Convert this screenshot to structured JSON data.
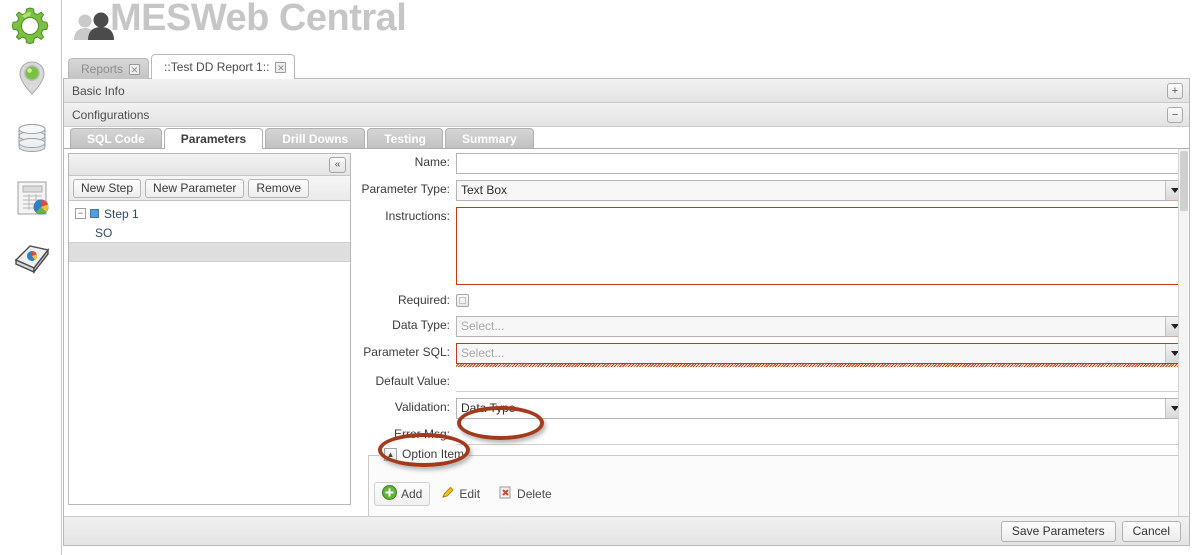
{
  "app": {
    "title": "MESWeb Central",
    "gear_icon": "gear-icon",
    "users_icon": "users-icon"
  },
  "rail": {
    "items": [
      {
        "icon": "location-pin-icon",
        "label": "Location"
      },
      {
        "icon": "database-icon",
        "label": "Database"
      },
      {
        "icon": "report-chart-icon",
        "label": "Reports"
      },
      {
        "icon": "report-stack-icon",
        "label": "Report Library"
      }
    ]
  },
  "top_tabs": [
    {
      "label": "Reports",
      "active": false,
      "close_icon": "close-icon"
    },
    {
      "label": "::Test DD Report 1::",
      "active": true,
      "close_icon": "close-icon"
    }
  ],
  "accordion": {
    "basic_info": {
      "label": "Basic Info",
      "button": "+",
      "button_icon": "plus-icon"
    },
    "configurations": {
      "label": "Configurations",
      "button": "−",
      "button_icon": "minus-icon"
    }
  },
  "inner_tabs": [
    {
      "label": "SQL Code",
      "active": false
    },
    {
      "label": "Parameters",
      "active": true
    },
    {
      "label": "Drill Downs",
      "active": false
    },
    {
      "label": "Testing",
      "active": false
    },
    {
      "label": "Summary",
      "active": false
    }
  ],
  "tree_panel": {
    "collapse_button": "«",
    "collapse_icon": "chevron-double-left-icon",
    "toolbar": [
      {
        "label": "New Step"
      },
      {
        "label": "New Parameter"
      },
      {
        "label": "Remove"
      }
    ],
    "nodes": [
      {
        "label": "Step 1",
        "expander": "−",
        "level": 0
      },
      {
        "label": "SO",
        "level": 1
      }
    ]
  },
  "form": {
    "name": {
      "label": "Name:",
      "value": "",
      "placeholder": ""
    },
    "parameter_type": {
      "label": "Parameter Type:",
      "value": "Text Box"
    },
    "instructions": {
      "label": "Instructions:",
      "value": ""
    },
    "required": {
      "label": "Required:",
      "checked": false
    },
    "data_type": {
      "label": "Data Type:",
      "value": "Select..."
    },
    "parameter_sql": {
      "label": "Parameter SQL:",
      "value": "Select...",
      "invalid": true
    },
    "default_value": {
      "label": "Default Value:",
      "value": ""
    },
    "validation": {
      "label": "Validation:",
      "value": "Data Type"
    },
    "error_msg": {
      "label": "Error Msg:",
      "value": ""
    }
  },
  "option_item": {
    "legend": "Option Item",
    "toggle": "▲",
    "toggle_icon": "triangle-up-icon",
    "buttons": [
      {
        "label": "Add",
        "icon": "add-circle-icon"
      },
      {
        "label": "Edit",
        "icon": "pencil-icon"
      },
      {
        "label": "Delete",
        "icon": "delete-icon"
      }
    ]
  },
  "footer": {
    "save": "Save Parameters",
    "cancel": "Cancel"
  },
  "colors": {
    "accent_green": "#7ac143",
    "error_red": "#bf3b17",
    "annotation": "#a23b1c",
    "title_gray": "#c6c6c6"
  }
}
